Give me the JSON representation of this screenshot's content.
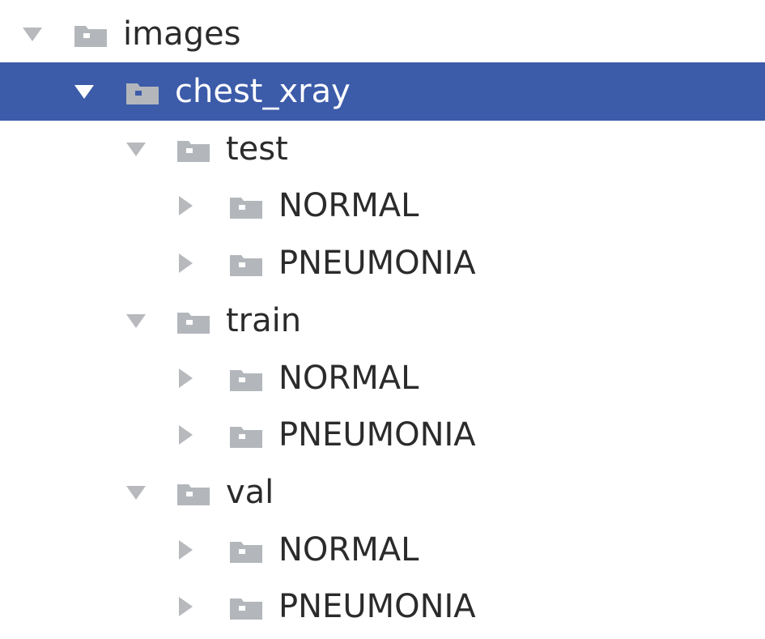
{
  "tree": {
    "root": {
      "label": "images",
      "icon": "folder-icon",
      "expanded": true,
      "children": {
        "dataset": {
          "label": "chest_xray",
          "icon": "folder-icon",
          "expanded": true,
          "selected": true,
          "children": {
            "test": {
              "label": "test",
              "expanded": true,
              "children": [
                {
                  "label": "NORMAL",
                  "expanded": false
                },
                {
                  "label": "PNEUMONIA",
                  "expanded": false
                }
              ]
            },
            "train": {
              "label": "train",
              "expanded": true,
              "children": [
                {
                  "label": "NORMAL",
                  "expanded": false
                },
                {
                  "label": "PNEUMONIA",
                  "expanded": false
                }
              ]
            },
            "val": {
              "label": "val",
              "expanded": true,
              "children": [
                {
                  "label": "NORMAL",
                  "expanded": false
                },
                {
                  "label": "PNEUMONIA",
                  "expanded": false
                }
              ]
            }
          }
        }
      }
    }
  },
  "colors": {
    "selection_background": "#3c5ba9",
    "selection_text": "#ffffff",
    "text": "#2b2b2b",
    "arrow": "#b7b9bd",
    "folder": "#b3b7bc"
  }
}
